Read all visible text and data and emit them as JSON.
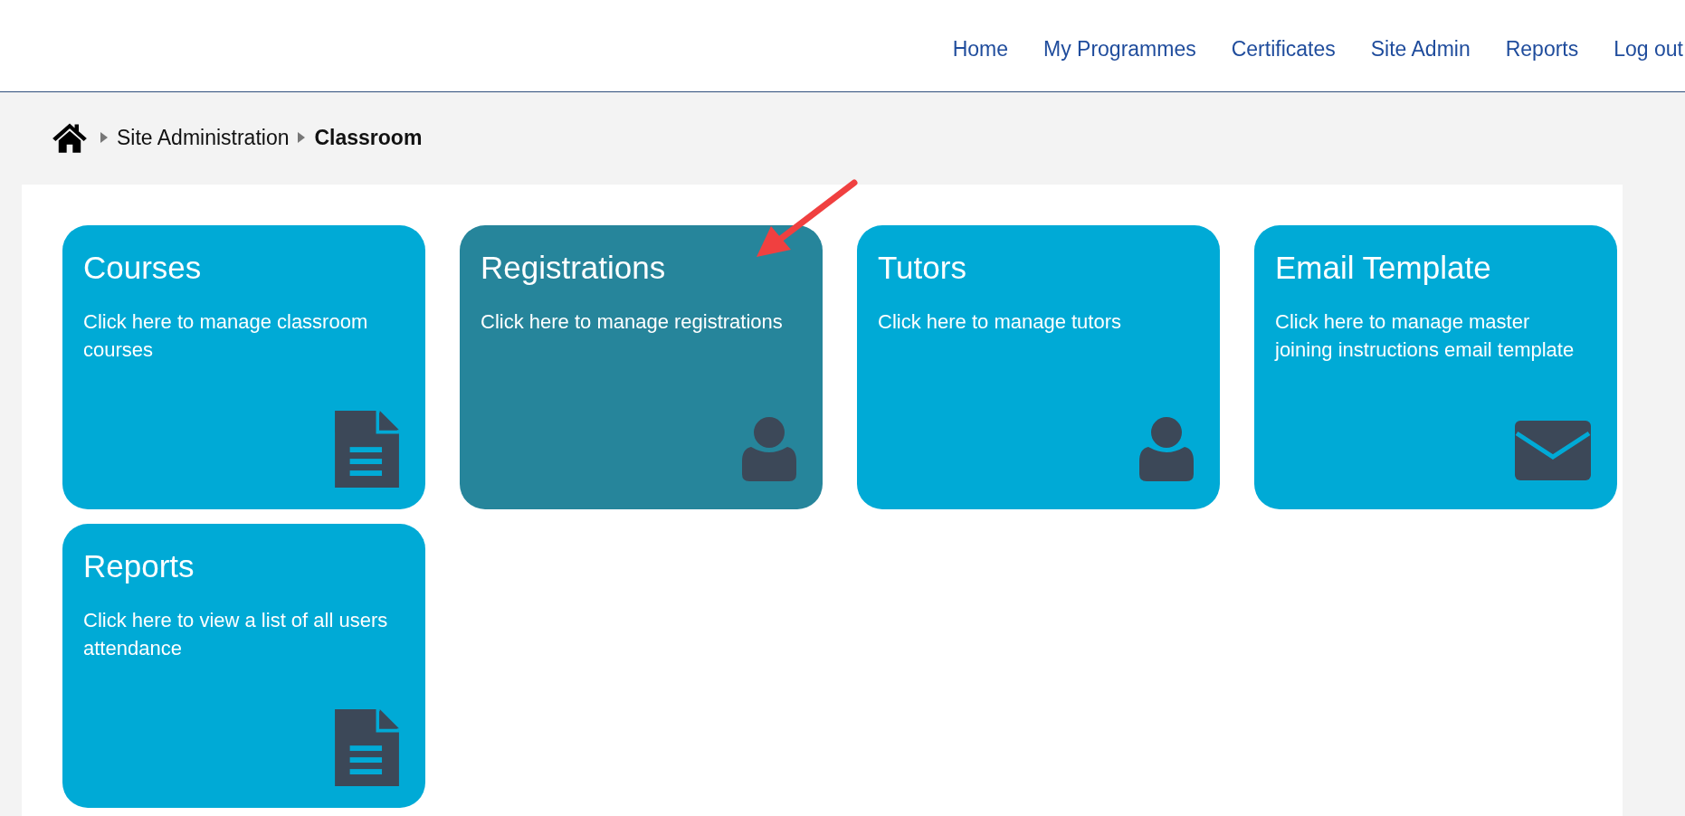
{
  "nav": [
    {
      "label": "Home"
    },
    {
      "label": "My Programmes"
    },
    {
      "label": "Certificates"
    },
    {
      "label": "Site Admin"
    },
    {
      "label": "Reports"
    },
    {
      "label": "Log out"
    }
  ],
  "breadcrumb": [
    {
      "label": "Site Administration",
      "current": false
    },
    {
      "label": "Classroom",
      "current": true
    }
  ],
  "cards": [
    {
      "title": "Courses",
      "description": "Click here to manage classroom courses",
      "kind": "document",
      "highlighted": false
    },
    {
      "title": "Registrations",
      "description": "Click here to manage registrations",
      "kind": "person",
      "highlighted": true
    },
    {
      "title": "Tutors",
      "description": "Click here to manage tutors",
      "kind": "person",
      "highlighted": false
    },
    {
      "title": "Email Template",
      "description": "Click here to manage master joining instructions email template",
      "kind": "envelope",
      "highlighted": false
    },
    {
      "title": "Reports",
      "description": "Click here to view a list of all users attendance",
      "kind": "document",
      "highlighted": false
    }
  ]
}
